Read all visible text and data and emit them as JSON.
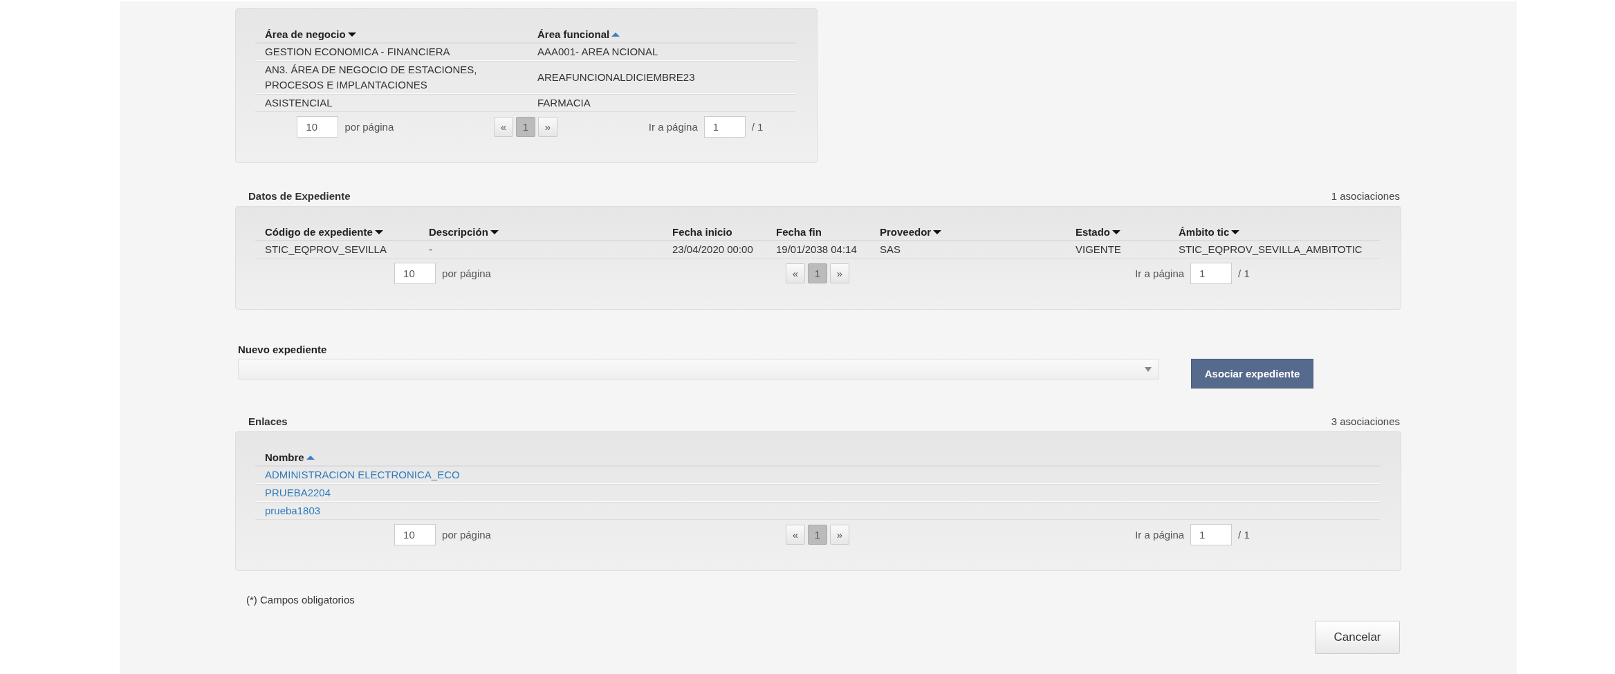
{
  "sections": [
    {
      "kind": "text",
      "columns": [
        {
          "label": "Área de negocio",
          "sortable": true,
          "ascending": false
        },
        {
          "label": "Área funcional",
          "sortable": true,
          "ascending": true
        }
      ],
      "rows": [
        [
          "GESTION ECONOMICA - FINANCIERA",
          "AAA001- AREA NCIONAL"
        ],
        [
          "AN3. ÁREA DE NEGOCIO DE ESTACIONES, PROCESOS E IMPLANTACIONES",
          "AREAFUNCIONALDICIEMBRE23"
        ],
        [
          "ASISTENCIAL",
          "FARMACIA"
        ]
      ],
      "pagination": {
        "per_page": "10",
        "per_page_label": "por página",
        "prev": "«",
        "pages": [
          {
            "label": "1",
            "selected": true
          }
        ],
        "next": "»",
        "goto_label": "Ir a página",
        "goto_value": "1",
        "total": "/ 1"
      }
    },
    {
      "title": "Datos de Expediente",
      "count": "1 asociaciones",
      "kind": "text",
      "columns": [
        {
          "label": "Código de expediente",
          "sortable": true,
          "ascending": false
        },
        {
          "label": "Descripción",
          "sortable": true,
          "ascending": false
        },
        {
          "label": "Fecha inicio",
          "sortable": false
        },
        {
          "label": "Fecha fin",
          "sortable": false
        },
        {
          "label": "Proveedor",
          "sortable": true,
          "ascending": false
        },
        {
          "label": "Estado",
          "sortable": true,
          "ascending": false
        },
        {
          "label": "Ámbito tic",
          "sortable": true,
          "ascending": false
        }
      ],
      "rows": [
        [
          "STIC_EQPROV_SEVILLA",
          "-",
          "23/04/2020 00:00",
          "19/01/2038 04:14",
          "SAS",
          "VIGENTE",
          "STIC_EQPROV_SEVILLA_AMBITOTIC"
        ]
      ],
      "pagination": {
        "per_page": "10",
        "per_page_label": "por página",
        "prev": "«",
        "pages": [
          {
            "label": "1",
            "selected": true
          }
        ],
        "next": "»",
        "goto_label": "Ir a página",
        "goto_value": "1",
        "total": "/ 1"
      }
    },
    {
      "title": "Enlaces",
      "count": "3 asociaciones",
      "kind": "link",
      "columns": [
        {
          "label": "Nombre",
          "sortable": true,
          "ascending": true
        }
      ],
      "rows": [
        [
          "ADMINISTRACION ELECTRONICA_ECO"
        ],
        [
          "PRUEBA2204"
        ],
        [
          "prueba1803"
        ]
      ],
      "pagination": {
        "per_page": "10",
        "per_page_label": "por página",
        "prev": "«",
        "pages": [
          {
            "label": "1",
            "selected": true
          }
        ],
        "next": "»",
        "goto_label": "Ir a página",
        "goto_value": "1",
        "total": "/ 1"
      }
    }
  ],
  "nuevo_expediente": {
    "label": "Nuevo expediente",
    "button": "Asociar expediente"
  },
  "footnote": "(*) Campos obligatorios",
  "cancel_button": "Cancelar"
}
